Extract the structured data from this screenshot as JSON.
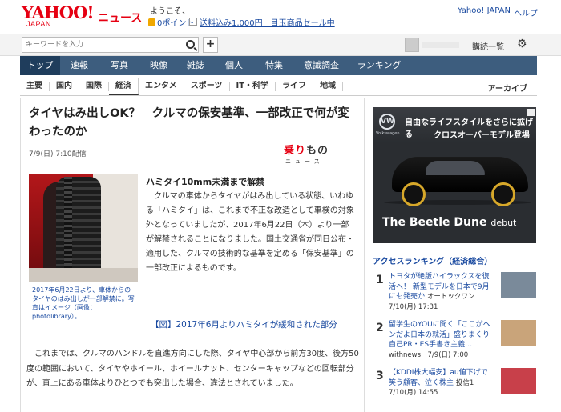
{
  "header": {
    "logo_text": "YAHOO!",
    "logo_sub": "JAPAN",
    "site_name": "ニュース",
    "welcome": "ようこそ、",
    "points": "0ポイント",
    "shipping_promo": "送料込み1,000円　目玉商品セール中",
    "yahoo_japan_link": "Yahoo! JAPAN",
    "help_link": "ヘルプ"
  },
  "search": {
    "placeholder": "キーワードを入力",
    "plus_label": "+",
    "subscribe_link": "購読一覧"
  },
  "mainnav": {
    "items": [
      {
        "label": "トップ",
        "active": true
      },
      {
        "label": "速報"
      },
      {
        "label": "写真"
      },
      {
        "label": "映像"
      },
      {
        "label": "雑誌"
      },
      {
        "label": "個人"
      },
      {
        "label": "特集"
      },
      {
        "label": "意識調査"
      },
      {
        "label": "ランキング"
      }
    ]
  },
  "subnav": {
    "items": [
      {
        "label": "主要"
      },
      {
        "label": "国内"
      },
      {
        "label": "国際"
      },
      {
        "label": "経済",
        "active": true
      },
      {
        "label": "エンタメ"
      },
      {
        "label": "スポーツ"
      },
      {
        "label": "IT・科学"
      },
      {
        "label": "ライフ"
      },
      {
        "label": "地域"
      }
    ],
    "archive": "アーカイブ"
  },
  "article": {
    "title": "タイヤはみ出しOK？　クルマの保安基準、一部改正で何が変わったのか",
    "date": "7/9(日) 7:10配信",
    "source_logo": {
      "chars": [
        "乗",
        "り",
        "も",
        "の"
      ],
      "sub": "ニュース",
      "colors": [
        "#e60012",
        "#e60012",
        "#333333",
        "#333333"
      ]
    },
    "photo_caption": "2017年6月22日より、車体からのタイヤのはみ出しが一部解禁に。写真はイメージ（画像：photolibrary）。",
    "section_heading": "ハミタイ10mm未満まで解禁",
    "paragraph1": "クルマの車体からタイヤがはみ出している状態、いわゆる「ハミタイ」は、これまで不正な改造として車検の対象外となっていましたが、2017年6月22日（木）より一部が解禁されることになりました。国土交通省が同日公布・適用した、クルマの技術的な基準を定める「保安基準」の一部改正によるものです。",
    "figure_link": "【図】2017年6月よりハミタイが緩和された部分",
    "paragraph2": "これまでは、クルマのハンドルを直進方向にした際、タイヤ中心部から前方30度、後方50度の範囲において、タイヤやホイール、ホイールナット、センターキャップなどの回転部分が、直上にある車体よりひとつでも突出した場合、違法とされていました。"
  },
  "ad": {
    "brand_mark": "VW",
    "brand_label": "Volkswagen",
    "copy_line1": "自由なライフスタイルをさらに拡げる",
    "copy_line2": "クロスオーバーモデル登場",
    "headline": "The Beetle Dune",
    "headline_suffix": "debut",
    "adchoices": "i"
  },
  "ranking": {
    "title": "アクセスランキング（経済総合）",
    "items": [
      {
        "rank": "1",
        "text": "トヨタが絶版ハイラックスを復活へ！ 新型モデルを日本で9月にも発売か",
        "meta": "オートックワン　7/10(月) 17:31",
        "thumb_color": "#7a8a9a"
      },
      {
        "rank": "2",
        "text": "留学生のYOUに聞く「ここがヘンだよ日本の就活」盛りまくり自己PR・ES手書き主義…",
        "meta": "withnews　7/9(日) 7:00",
        "thumb_color": "#c9a47a"
      },
      {
        "rank": "3",
        "text": "【KDDI株大幅安】au値下げで笑う顧客、泣く株主",
        "meta": "投信1　7/10(月) 14:55",
        "thumb_color": "#c8404a"
      }
    ]
  },
  "colors": {
    "brand_red": "#e60012",
    "nav_blue": "#3d5d7e",
    "link_blue": "#1a4aa0"
  }
}
